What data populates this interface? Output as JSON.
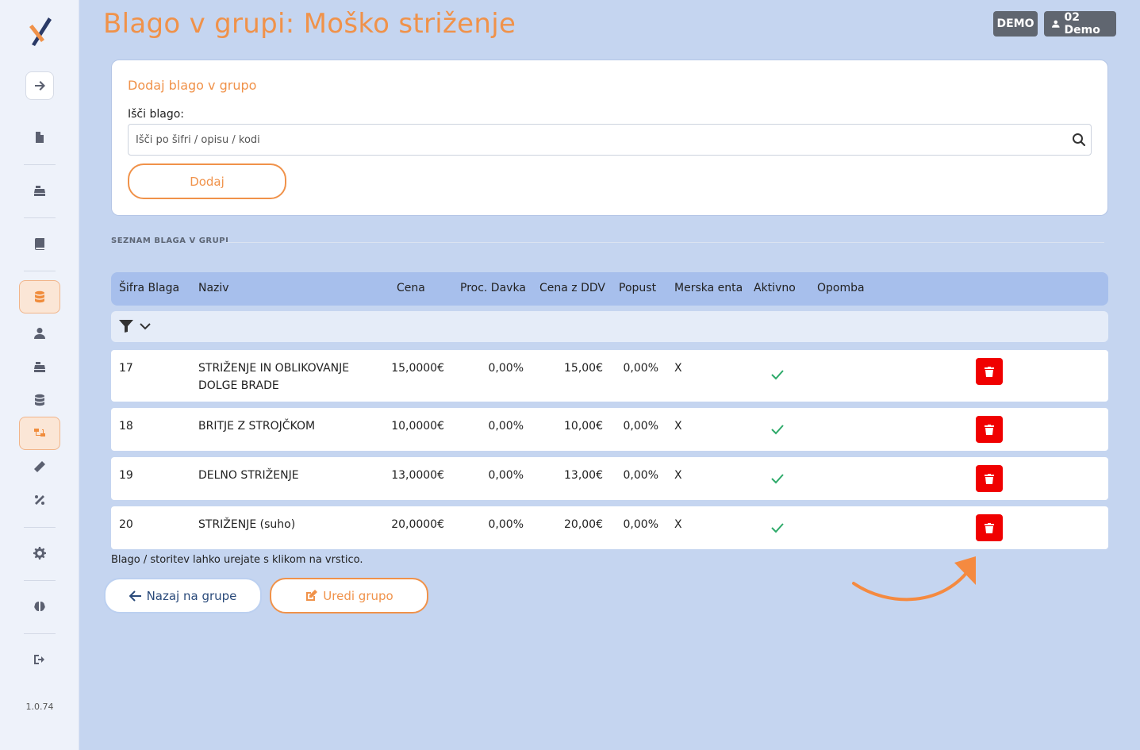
{
  "sidebar": {
    "version": "1.0.74",
    "icons": [
      "logo-icon",
      "arrow-right-icon",
      "document-icon",
      "cash-register-icon",
      "book-icon",
      "database-icon",
      "user-icon",
      "cash-register-icon",
      "database-icon",
      "group-icon",
      "ruler-icon",
      "percent-icon",
      "gear-icon",
      "brain-icon",
      "logout-icon"
    ]
  },
  "header": {
    "title": "Blago v grupi: Moško striženje",
    "demo_badge": "DEMO",
    "user_badge": "02 Demo"
  },
  "add_card": {
    "title": "Dodaj blago v grupo",
    "search_label": "Išči blago:",
    "search_placeholder": "Išči po šifri / opisu / kodi",
    "add_button": "Dodaj"
  },
  "section_label": "SEZNAM BLAGA V GRUPI",
  "table": {
    "headers": [
      "Šifra Blaga",
      "Naziv",
      "Cena",
      "Proc. Davka",
      "Cena z DDV",
      "Popust",
      "Merska enta",
      "Aktivno",
      "Opomba"
    ],
    "rows": [
      {
        "sifra": "17",
        "naziv": "STRIŽENJE IN OBLIKOVANJE DOLGE BRADE",
        "cena": "15,0000€",
        "davek": "0,00%",
        "cena_ddv": "15,00€",
        "popust": "0,00%",
        "enota": "X",
        "aktivno": true,
        "opomba": ""
      },
      {
        "sifra": "18",
        "naziv": "BRITJE Z STROJČKOM",
        "cena": "10,0000€",
        "davek": "0,00%",
        "cena_ddv": "10,00€",
        "popust": "0,00%",
        "enota": "X",
        "aktivno": true,
        "opomba": ""
      },
      {
        "sifra": "19",
        "naziv": "DELNO STRIŽENJE",
        "cena": "13,0000€",
        "davek": "0,00%",
        "cena_ddv": "13,00€",
        "popust": "0,00%",
        "enota": "X",
        "aktivno": true,
        "opomba": ""
      },
      {
        "sifra": "20",
        "naziv": "STRIŽENJE (suho)",
        "cena": "20,0000€",
        "davek": "0,00%",
        "cena_ddv": "20,00€",
        "popust": "0,00%",
        "enota": "X",
        "aktivno": true,
        "opomba": ""
      }
    ]
  },
  "hint": "Blago / storitev lahko urejate s klikom na vrstico.",
  "footer_buttons": {
    "back": "Nazaj na grupe",
    "edit": "Uredi grupo"
  },
  "colors": {
    "accent": "#f0924a",
    "delete": "#f00000",
    "check": "#2eaa6a",
    "table_header": "#a7bfec"
  }
}
